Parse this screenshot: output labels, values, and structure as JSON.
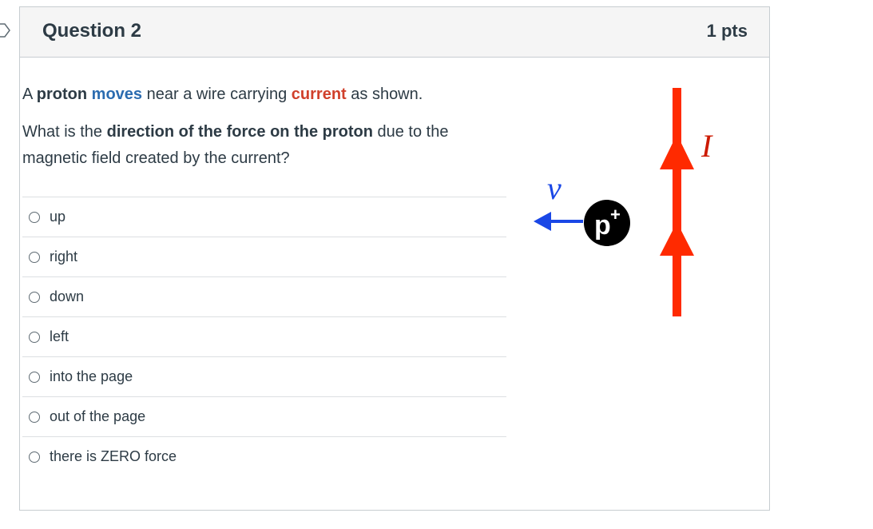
{
  "question": {
    "title": "Question 2",
    "points": "1 pts",
    "text_line1": {
      "a": "A ",
      "proton": "proton",
      "sp1": " ",
      "moves": "moves",
      "mid": " near a wire carrying ",
      "current": "current",
      "end": " as shown."
    },
    "text_line2": {
      "start": "What is the ",
      "emphasis": "direction of the force on the proton",
      "end": " due to the magnetic field created by the current?"
    }
  },
  "answers": [
    {
      "label": "up"
    },
    {
      "label": "right"
    },
    {
      "label": "down"
    },
    {
      "label": "left"
    },
    {
      "label": "into the page"
    },
    {
      "label": "out of the page"
    },
    {
      "label": "there is ZERO force"
    }
  ],
  "figure": {
    "velocity_label": "v",
    "proton_label": "p",
    "proton_charge": "+",
    "current_label": "I",
    "colors": {
      "wire": "#ff2a00",
      "velocity": "#1a47e6",
      "proton": "#000000"
    }
  }
}
